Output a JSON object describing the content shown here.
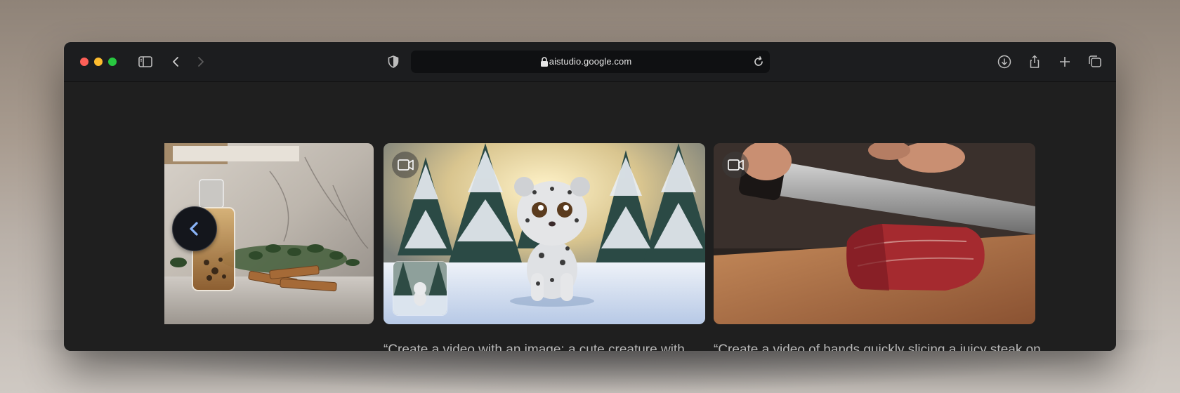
{
  "browser": {
    "url": "aistudio.google.com",
    "icons": [
      "sidebar-icon",
      "back-icon",
      "forward-icon",
      "shield-icon",
      "lock-icon",
      "reload-icon",
      "download-icon",
      "share-icon",
      "new-tab-icon",
      "tabs-overview-icon"
    ]
  },
  "gallery": {
    "prev_icon": "chevron-left-icon",
    "cards": [
      {
        "kind": "image",
        "subject": "perfume"
      },
      {
        "kind": "video",
        "badge_icon": "video-camera-icon",
        "caption": "“Create a video with an image: a cute creature with snow leopard-like fur is walking in a winter forest.”"
      },
      {
        "kind": "video",
        "badge_icon": "video-camera-icon",
        "caption": "“Create a video of hands quickly slicing a juicy steak on a wooden cutting board“"
      }
    ]
  },
  "colors": {
    "window_bg": "#1f1f1f",
    "toolbar_bg": "#1c1d1f",
    "caption": "#b9b9b9",
    "accent_chevron": "#8ab4f8"
  }
}
